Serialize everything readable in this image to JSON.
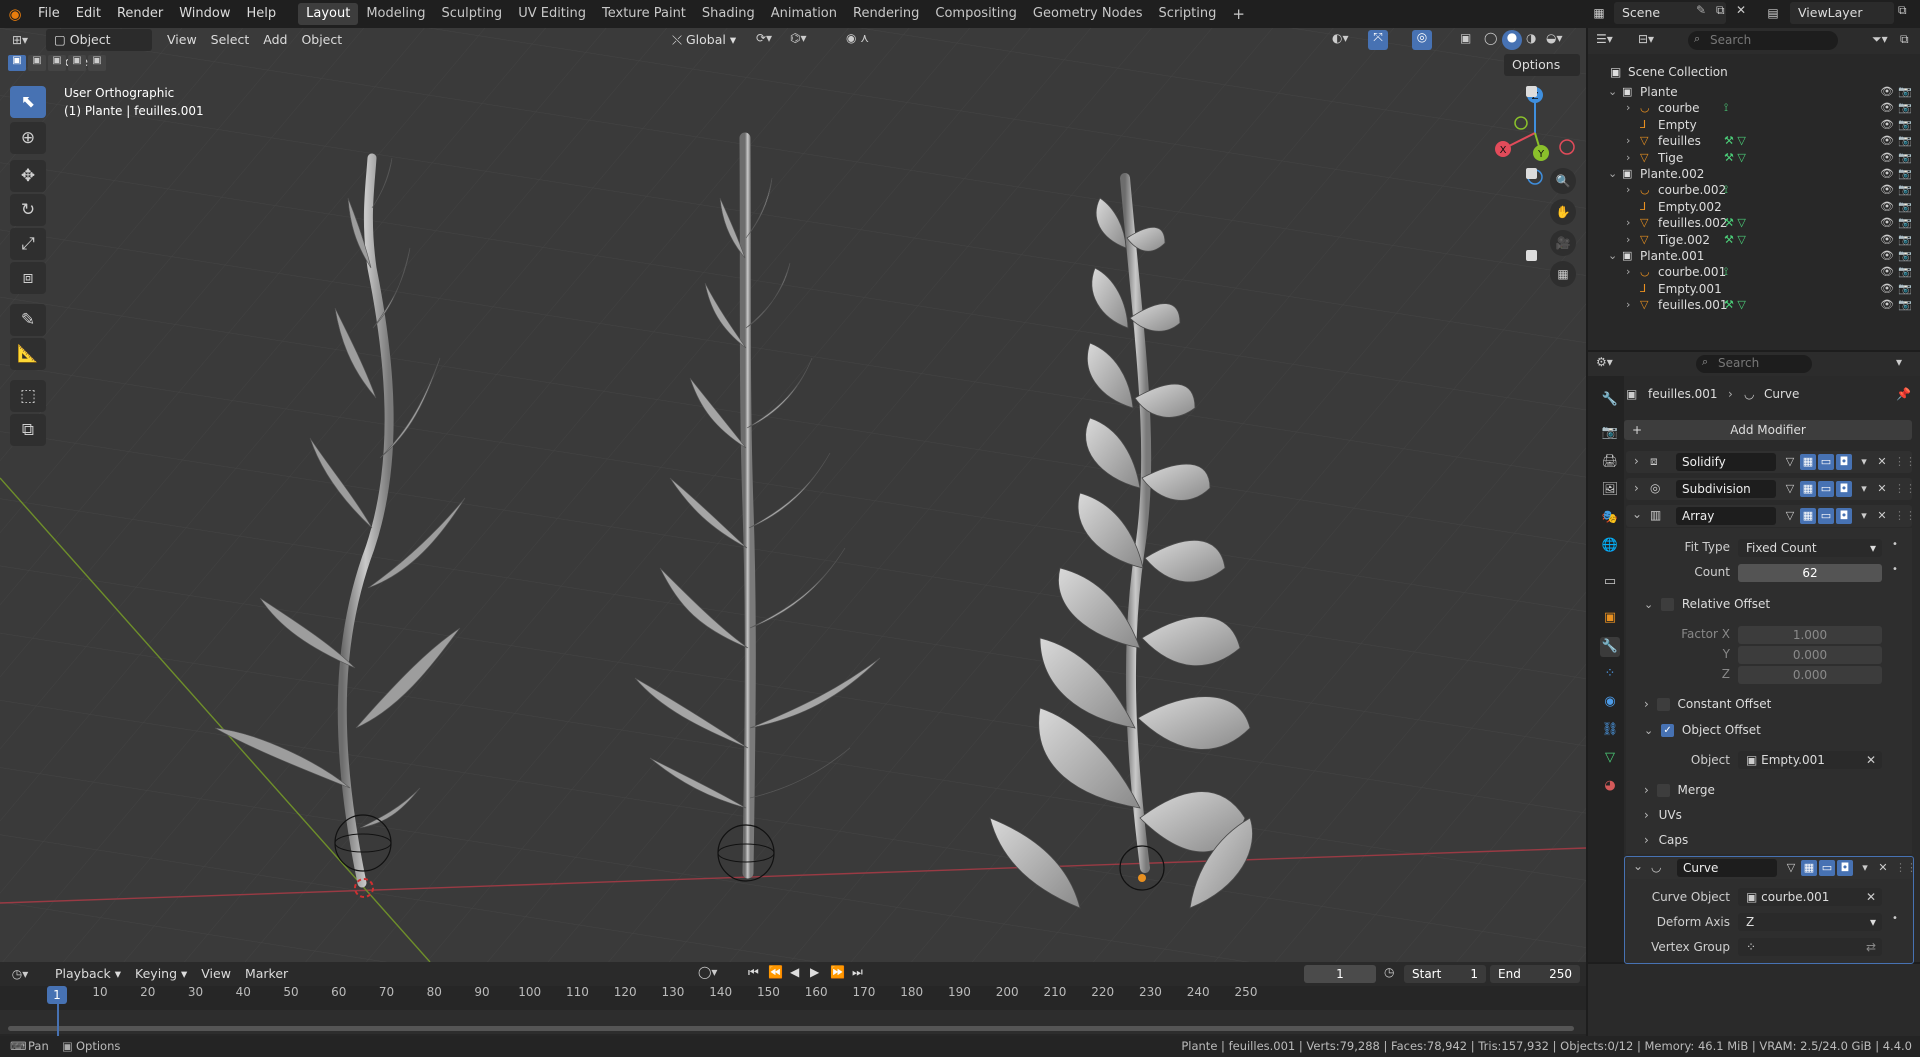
{
  "topbar": {
    "menus": [
      "File",
      "Edit",
      "Render",
      "Window",
      "Help"
    ],
    "workspaces": [
      "Layout",
      "Modeling",
      "Sculpting",
      "UV Editing",
      "Texture Paint",
      "Shading",
      "Animation",
      "Rendering",
      "Compositing",
      "Geometry Nodes",
      "Scripting"
    ],
    "active_workspace": "Layout",
    "add_tab": "+",
    "scene": "Scene",
    "view_layer": "ViewLayer"
  },
  "viewport_header": {
    "mode": "Object Mode",
    "menus": [
      "View",
      "Select",
      "Add",
      "Object"
    ],
    "transform_orientation": "Global",
    "options_label": "Options"
  },
  "viewport": {
    "view_name": "User Orthographic",
    "context": "(1) Plante | feuilles.001",
    "gizmo": {
      "x": "X",
      "y": "Y",
      "z": "Z"
    }
  },
  "outliner": {
    "search_placeholder": "Search",
    "root": "Scene Collection",
    "rows": [
      {
        "label": "Plante",
        "type": "collection"
      },
      {
        "label": "courbe",
        "type": "curve"
      },
      {
        "label": "Empty",
        "type": "empty"
      },
      {
        "label": "feuilles",
        "type": "mesh"
      },
      {
        "label": "Tige",
        "type": "mesh"
      },
      {
        "label": "Plante.002",
        "type": "collection"
      },
      {
        "label": "courbe.002",
        "type": "curve"
      },
      {
        "label": "Empty.002",
        "type": "empty"
      },
      {
        "label": "feuilles.002",
        "type": "mesh"
      },
      {
        "label": "Tige.002",
        "type": "mesh"
      },
      {
        "label": "Plante.001",
        "type": "collection"
      },
      {
        "label": "courbe.001",
        "type": "curve"
      },
      {
        "label": "Empty.001",
        "type": "empty"
      },
      {
        "label": "feuilles.001",
        "type": "mesh"
      }
    ]
  },
  "properties": {
    "search_placeholder": "Search",
    "breadcrumb_object": "feuilles.001",
    "breadcrumb_modifier": "Curve",
    "add_modifier": "Add Modifier",
    "modifiers": [
      "Solidify",
      "Subdivision",
      "Array",
      "Curve"
    ],
    "array": {
      "fit_type_label": "Fit Type",
      "fit_type": "Fixed Count",
      "count_label": "Count",
      "count": "62",
      "relative_offset": "Relative Offset",
      "factor_x_label": "Factor X",
      "factor_x": "1.000",
      "y_label": "Y",
      "y": "0.000",
      "z_label": "Z",
      "z": "0.000",
      "constant_offset": "Constant Offset",
      "object_offset": "Object Offset",
      "object_label": "Object",
      "object": "Empty.001",
      "merge": "Merge",
      "uvs": "UVs",
      "caps": "Caps"
    },
    "curve": {
      "curve_object_label": "Curve Object",
      "curve_object": "courbe.001",
      "deform_axis_label": "Deform Axis",
      "deform_axis": "Z",
      "vertex_group_label": "Vertex Group"
    }
  },
  "timeline": {
    "menus": [
      "Playback",
      "Keying",
      "View",
      "Marker"
    ],
    "current_frame": "1",
    "start_label": "Start",
    "start": "1",
    "end_label": "End",
    "end": "250",
    "ticks": [
      "1",
      "10",
      "20",
      "30",
      "40",
      "50",
      "60",
      "70",
      "80",
      "90",
      "100",
      "110",
      "120",
      "130",
      "140",
      "150",
      "160",
      "170",
      "180",
      "190",
      "200",
      "210",
      "220",
      "230",
      "240",
      "250"
    ]
  },
  "statusbar": {
    "left_pan": "Pan",
    "left_options": "Options",
    "right": "Plante | feuilles.001 | Verts:79,288 | Faces:78,942 | Tris:157,932 | Objects:0/12 | Memory: 46.1 MiB | VRAM: 2.5/24.0 GiB | 4.4.0"
  },
  "colors": {
    "accent": "#4772b3",
    "x_axis": "#e24b5a",
    "y_axis": "#8ac02b",
    "z_axis": "#3f8fde"
  }
}
